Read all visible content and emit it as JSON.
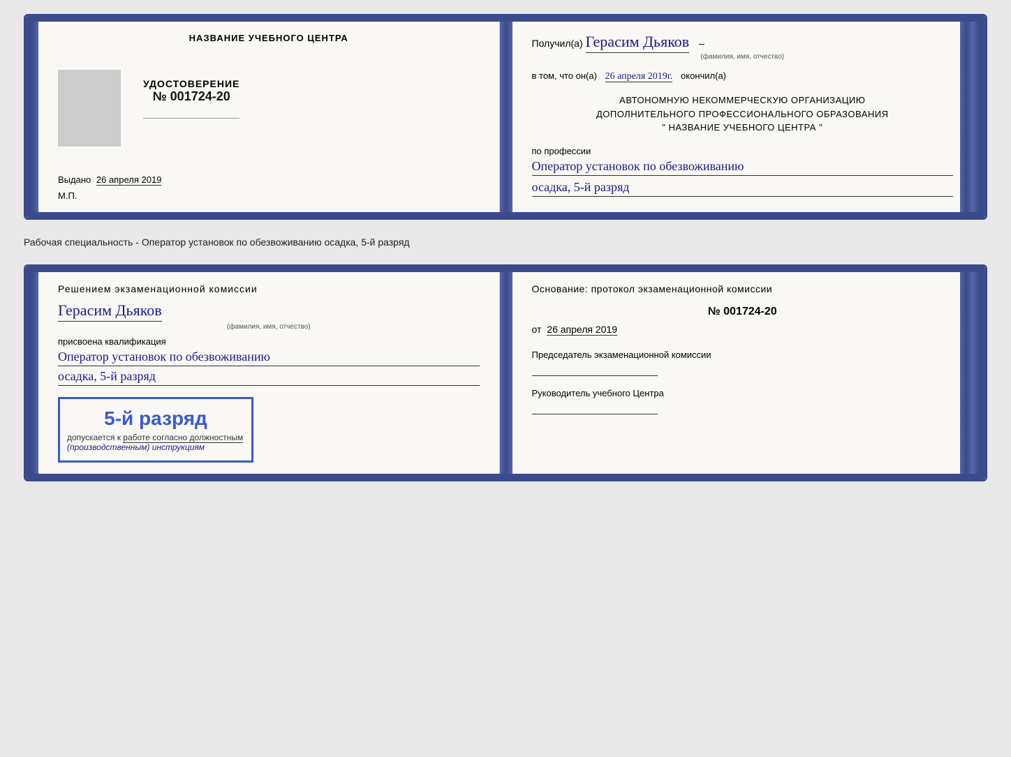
{
  "top_card": {
    "left": {
      "center_title": "НАЗВАНИЕ УЧЕБНОГО ЦЕНТРА",
      "cert_label": "УДОСТОВЕРЕНИЕ",
      "cert_prefix": "№",
      "cert_number": "001724-20",
      "issued_prefix": "Выдано",
      "issued_date": "26 апреля 2019",
      "mp_label": "М.П."
    },
    "right": {
      "received_prefix": "Получил(а)",
      "received_name": "Герасим Дьяков",
      "name_subtitle": "(фамилия, имя, отчество)",
      "date_prefix": "в том, что он(а)",
      "date_value": "26 апреля 2019г.",
      "date_suffix": "окончил(а)",
      "org_line1": "АВТОНОМНУЮ НЕКОММЕРЧЕСКУЮ ОРГАНИЗАЦИЮ",
      "org_line2": "ДОПОЛНИТЕЛЬНОГО ПРОФЕССИОНАЛЬНОГО ОБРАЗОВАНИЯ",
      "org_line3": "\"   НАЗВАНИЕ УЧЕБНОГО ЦЕНТРА   \"",
      "profession_label": "по профессии",
      "profession_value": "Оператор установок по обезвоживанию",
      "rank_value": "осадка, 5-й разряд"
    }
  },
  "separator": {
    "label": "Рабочая специальность - Оператор установок по обезвоживанию осадка, 5-й разряд"
  },
  "bottom_card": {
    "left": {
      "decision_title": "Решением экзаменационной комиссии",
      "person_name": "Герасим Дьяков",
      "name_subtitle": "(фамилия, имя, отчество)",
      "assigned_label": "присвоена квалификация",
      "qualification_value": "Оператор установок по обезвоживанию",
      "rank_value": "осадка, 5-й разряд",
      "stamp_rank": "5-й разряд",
      "stamp_prefix": "допускается к",
      "stamp_underline": "работе согласно должностным",
      "stamp_italic": "(производственным) инструкциям"
    },
    "right": {
      "basis_title": "Основание: протокол экзаменационной комиссии",
      "protocol_prefix": "№",
      "protocol_number": "001724-20",
      "date_prefix": "от",
      "date_value": "26 апреля 2019",
      "chairman_label": "Председатель экзаменационной комиссии",
      "head_label": "Руководитель учебного Центра"
    }
  }
}
